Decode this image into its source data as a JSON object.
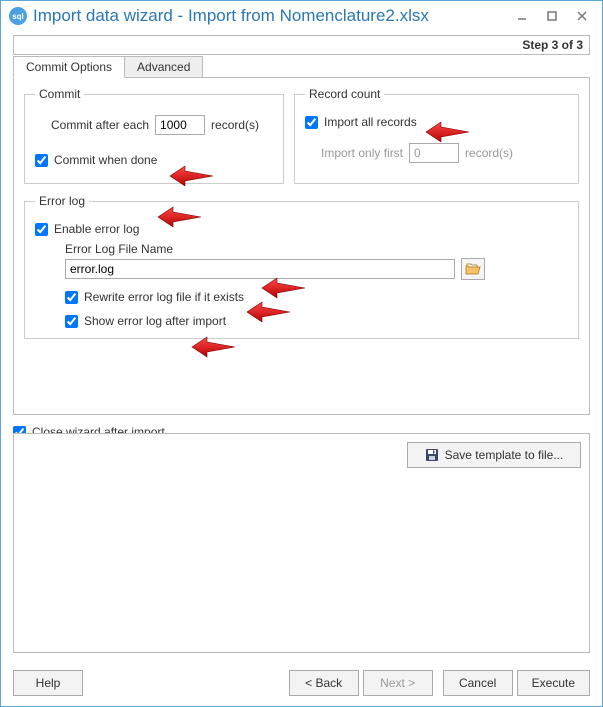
{
  "window": {
    "title": "Import data wizard - Import from Nomenclature2.xlsx",
    "step_label": "Step 3 of 3"
  },
  "tabs": {
    "commit_options": "Commit Options",
    "advanced": "Advanced"
  },
  "commit": {
    "legend": "Commit",
    "after_each_label": "Commit after each",
    "after_each_value": "1000",
    "records_suffix": "record(s)",
    "when_done_label": "Commit when done",
    "when_done_checked": true
  },
  "record_count": {
    "legend": "Record count",
    "import_all_label": "Import all records",
    "import_all_checked": true,
    "only_first_label": "Import only first",
    "only_first_value": "0",
    "records_suffix": "record(s)"
  },
  "error_log": {
    "legend": "Error log",
    "enable_label": "Enable error log",
    "enable_checked": true,
    "file_label": "Error Log File Name",
    "file_value": "error.log",
    "rewrite_label": "Rewrite error log file if it exists",
    "rewrite_checked": true,
    "show_after_label": "Show error log after import",
    "show_after_checked": true
  },
  "close_wizard": {
    "label": "Close wizard after import",
    "checked": true
  },
  "template": {
    "save_label": "Save template to file..."
  },
  "buttons": {
    "help": "Help",
    "back": "< Back",
    "next": "Next >",
    "cancel": "Cancel",
    "execute": "Execute"
  },
  "icons": {
    "app": "sql",
    "browse": "folder-open",
    "save": "floppy"
  }
}
